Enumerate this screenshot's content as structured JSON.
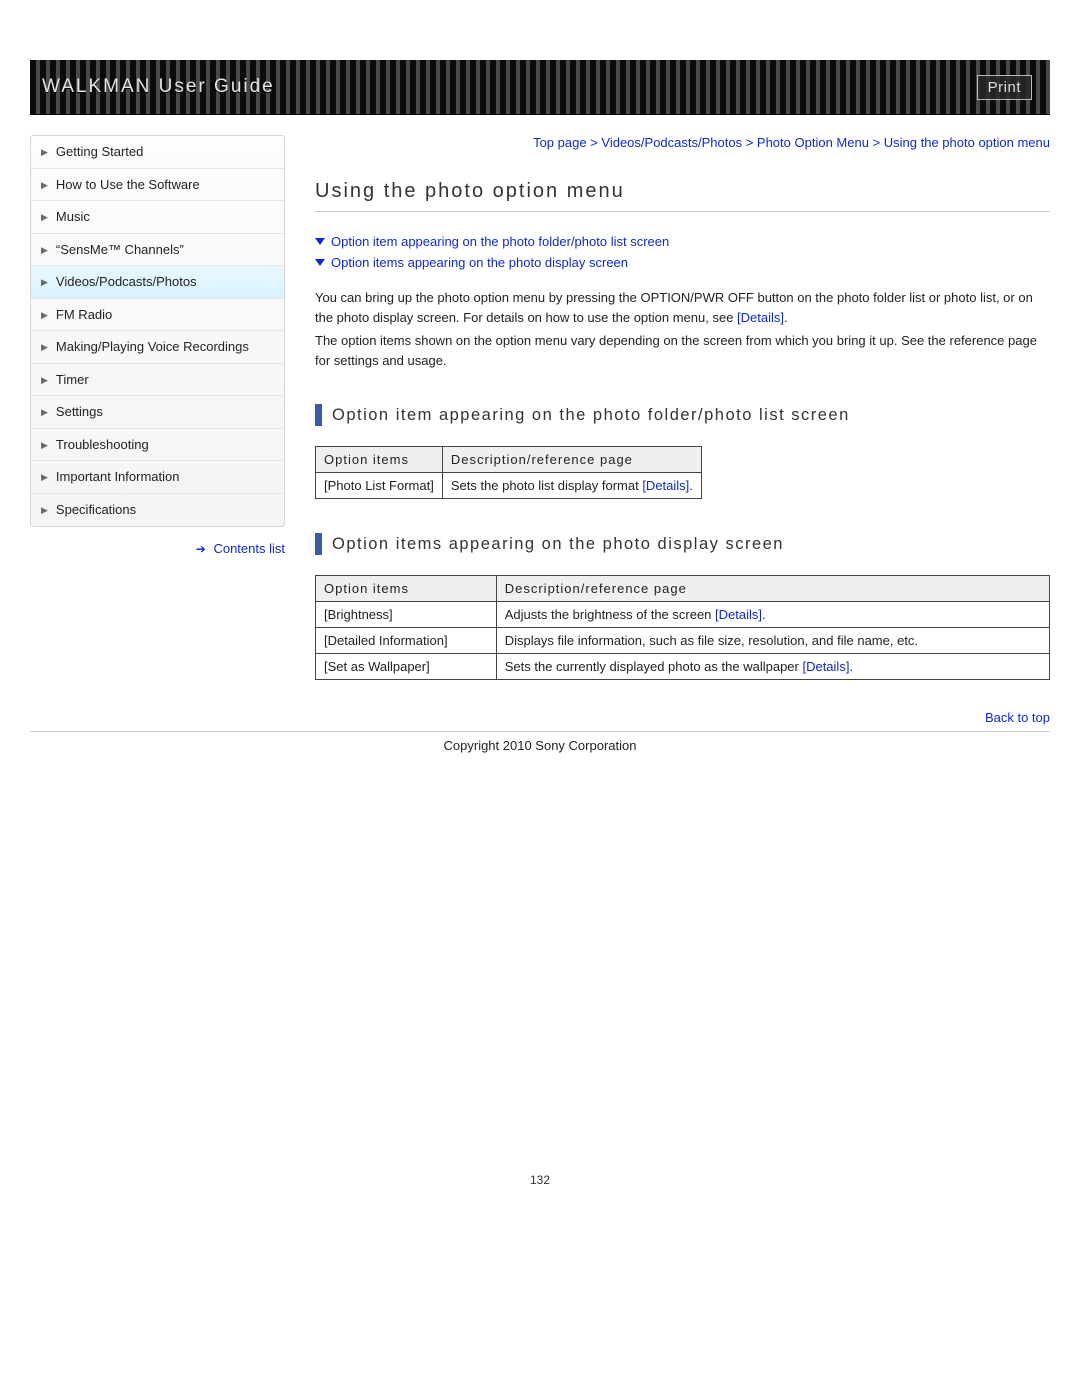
{
  "header": {
    "title": "WALKMAN User Guide",
    "print": "Print"
  },
  "sidebar": [
    {
      "label": "Getting Started",
      "active": false
    },
    {
      "label": "How to Use the Software",
      "active": false
    },
    {
      "label": "Music",
      "active": false
    },
    {
      "label": "“SensMe™ Channels”",
      "active": false
    },
    {
      "label": "Videos/Podcasts/Photos",
      "active": true
    },
    {
      "label": "FM Radio",
      "active": false
    },
    {
      "label": "Making/Playing Voice Recordings",
      "active": false
    },
    {
      "label": "Timer",
      "active": false
    },
    {
      "label": "Settings",
      "active": false
    },
    {
      "label": "Troubleshooting",
      "active": false
    },
    {
      "label": "Important Information",
      "active": false
    },
    {
      "label": "Specifications",
      "active": false
    }
  ],
  "contents_list_label": "Contents list",
  "breadcrumb": {
    "items": [
      "Top page",
      "Videos/Podcasts/Photos",
      "Photo Option Menu",
      "Using the photo option menu"
    ],
    "sep": " > "
  },
  "page_title": "Using the photo option menu",
  "anchor_links": [
    "Option item appearing on the photo folder/photo list screen",
    "Option items appearing on the photo display screen"
  ],
  "intro": {
    "p1a": "You can bring up the photo option menu by pressing the OPTION/PWR OFF button on the photo folder list or photo list, or on the photo display screen. For details on how to use the option menu, see ",
    "details": "[Details]",
    "p1b": ".",
    "p2": "The option items shown on the option menu vary depending on the screen from which you bring it up. See the reference page for settings and usage."
  },
  "section1": {
    "title": "Option item appearing on the photo folder/photo list screen",
    "headers": [
      "Option items",
      "Description/reference page"
    ],
    "rows": [
      {
        "option": "[Photo List Format]",
        "desc_pre": "Sets the photo list display format ",
        "link": "[Details]",
        "desc_post": "."
      }
    ]
  },
  "section2": {
    "title": "Option items appearing on the photo display screen",
    "headers": [
      "Option items",
      "Description/reference page"
    ],
    "rows": [
      {
        "option": "[Brightness]",
        "desc_pre": "Adjusts the brightness of the screen ",
        "link": "[Details]",
        "desc_post": "."
      },
      {
        "option": "[Detailed Information]",
        "desc_pre": "Displays file information, such as file size, resolution, and file name, etc.",
        "link": "",
        "desc_post": ""
      },
      {
        "option": "[Set as Wallpaper]",
        "desc_pre": "Sets the currently displayed photo as the wallpaper ",
        "link": "[Details]",
        "desc_post": "."
      }
    ]
  },
  "back_to_top": "Back to top",
  "copyright": "Copyright 2010 Sony Corporation",
  "page_number": "132"
}
